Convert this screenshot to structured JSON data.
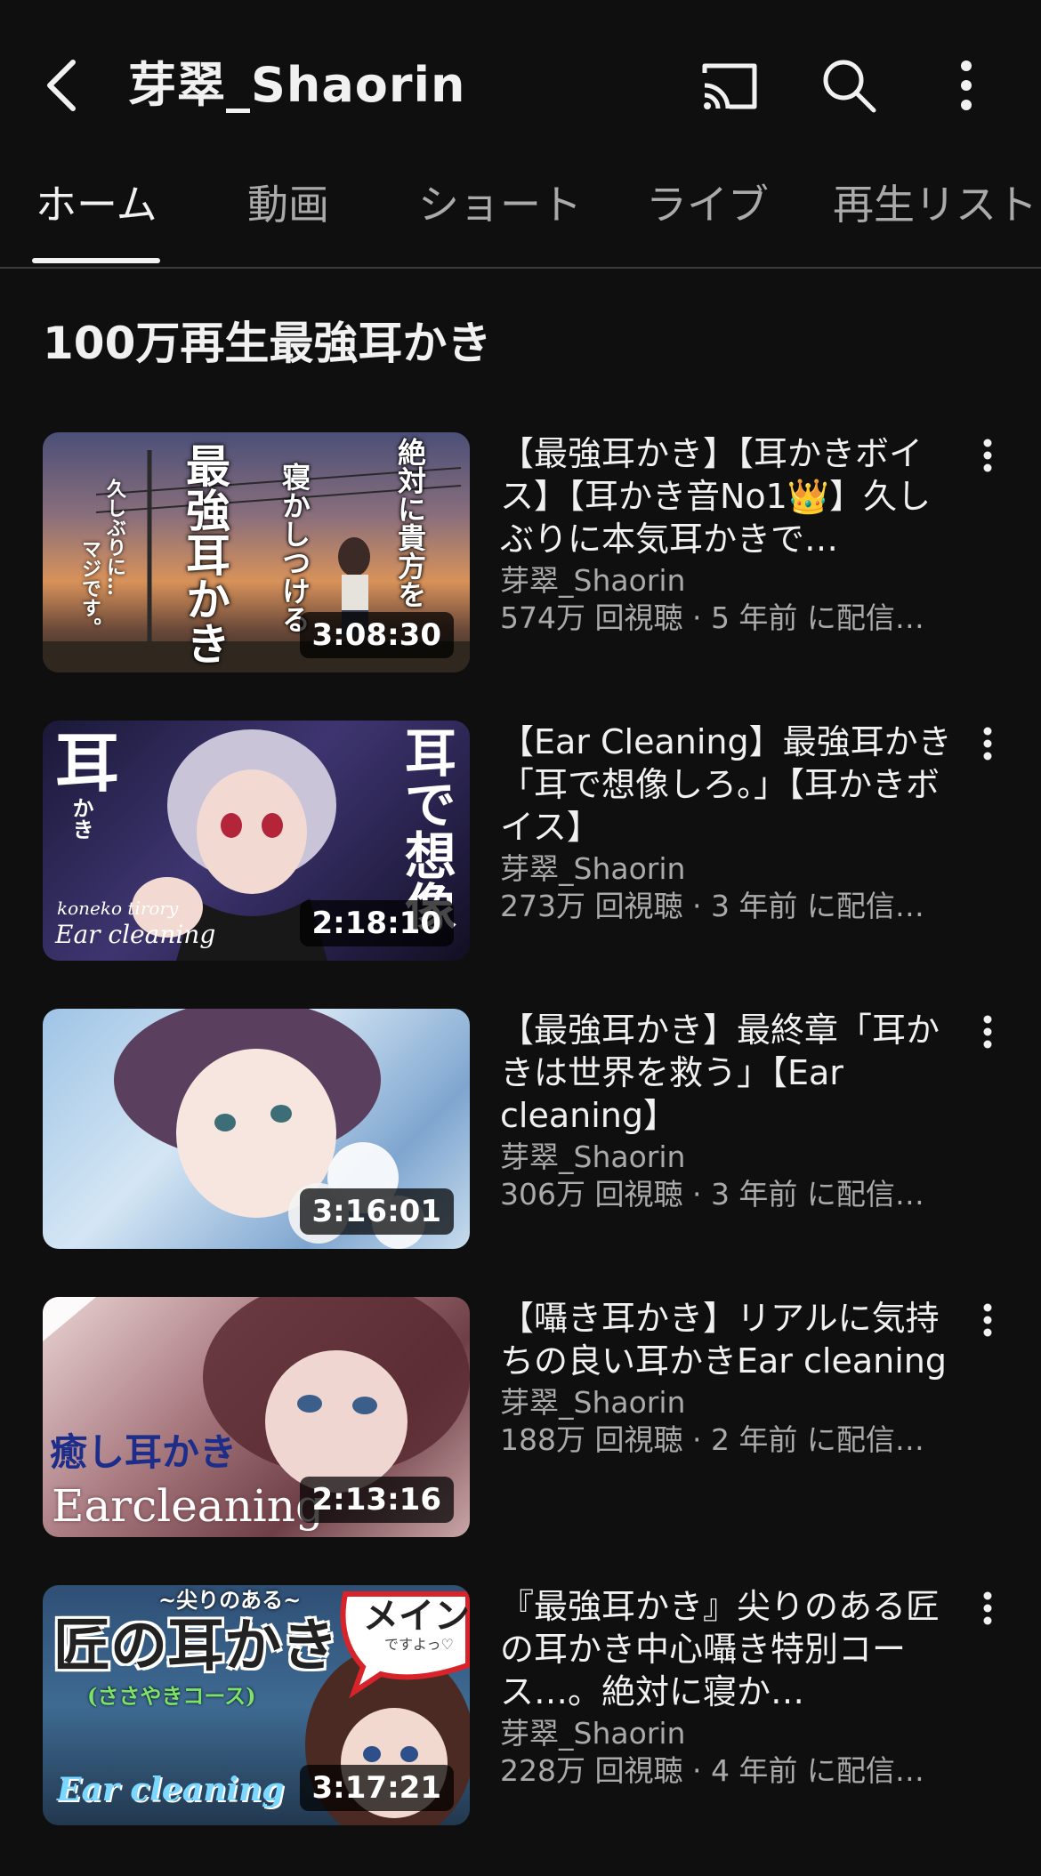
{
  "header": {
    "channel_name": "芽翠_Shaorin",
    "icons": [
      "back-arrow-icon",
      "cast-icon",
      "search-icon",
      "more-vert-icon"
    ]
  },
  "tabs": [
    {
      "label": "ホーム",
      "active": true
    },
    {
      "label": "動画",
      "active": false
    },
    {
      "label": "ショート",
      "active": false
    },
    {
      "label": "ライブ",
      "active": false
    },
    {
      "label": "再生リスト",
      "active": false
    }
  ],
  "section": {
    "title": "100万再生最強耳かき"
  },
  "videos": [
    {
      "title": "【最強耳かき】【耳かきボイス】【耳かき音No1👑】久しぶりに本気耳かきで…",
      "channel": "芽翠_Shaorin",
      "meta": "574万 回視聴 · 5 年前 に配信…",
      "duration": "3:08:30",
      "thumb_text": [
        "最強耳かき",
        "寝かしつける",
        "絶対に貴方を",
        "久しぶりに…",
        "マジです。"
      ]
    },
    {
      "title": "【Ear Cleaning】最強耳かき「耳で想像しろ。」【耳かきボイス】",
      "channel": "芽翠_Shaorin",
      "meta": "273万 回視聴 · 3 年前 に配信…",
      "duration": "2:18:10",
      "thumb_text": [
        "耳",
        "かき",
        "耳で想像",
        "koneko tirory",
        "Ear cleaning"
      ]
    },
    {
      "title": "【最強耳かき】最終章「耳かきは世界を救う」【Ear cleaning】",
      "channel": "芽翠_Shaorin",
      "meta": "306万 回視聴 · 3 年前 に配信…",
      "duration": "3:16:01",
      "thumb_text": []
    },
    {
      "title": "【囁き耳かき】リアルに気持ちの良い耳かきEar cleaning",
      "channel": "芽翠_Shaorin",
      "meta": "188万 回視聴 · 2 年前 に配信…",
      "duration": "2:13:16",
      "thumb_text": [
        "癒し耳かき",
        "Earcleaning"
      ]
    },
    {
      "title": "『最強耳かき』尖りのある匠の耳かき中心囁き特別コース…。絶対に寝か…",
      "channel": "芽翠_Shaorin",
      "meta": "228万 回視聴 · 4 年前 に配信…",
      "duration": "3:17:21",
      "thumb_text": [
        "~尖りのある~",
        "匠の耳かき",
        "(ささやきコース)",
        "メイン",
        "ですよっ♡",
        "Ear cleaning"
      ]
    }
  ],
  "colors": {
    "background": "#0f0f0f",
    "text_primary": "#f1f1f1",
    "text_secondary": "#aaaaaa"
  }
}
